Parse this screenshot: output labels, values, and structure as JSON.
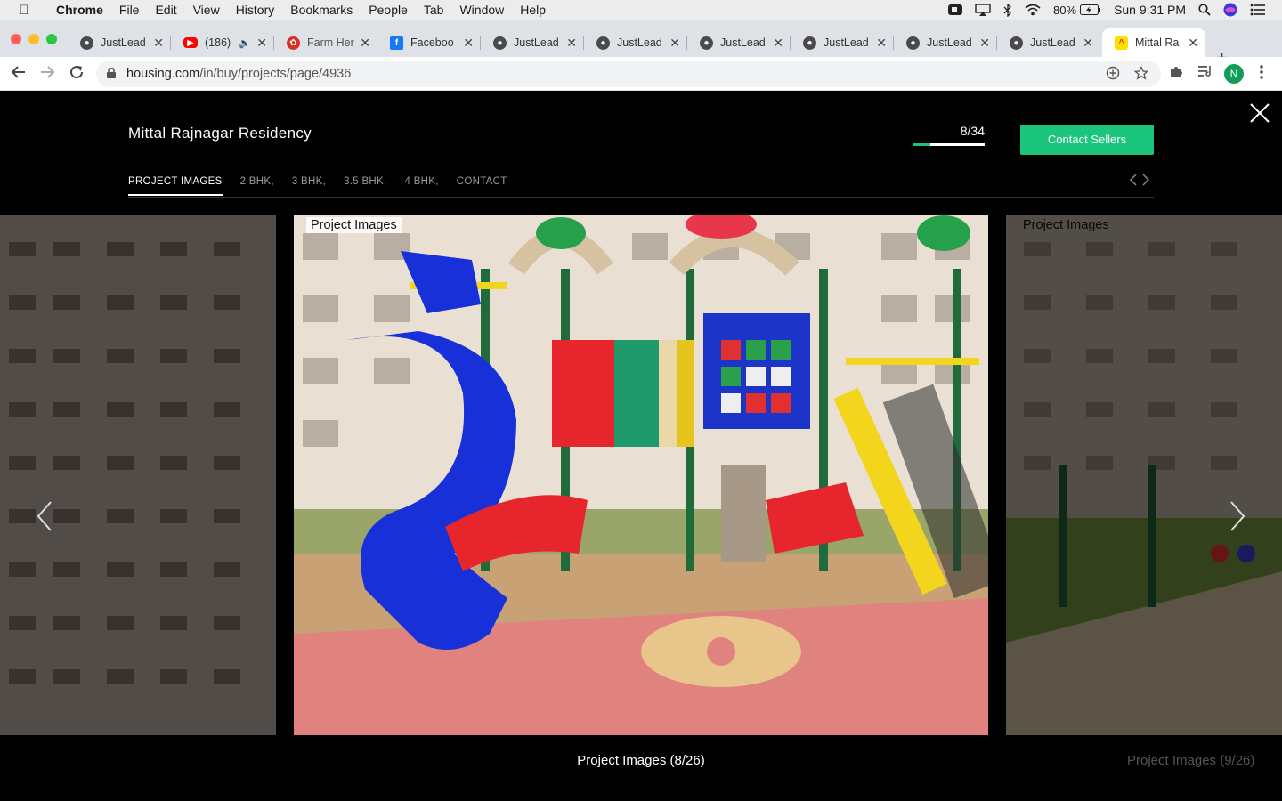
{
  "menubar": {
    "items": [
      "Chrome",
      "File",
      "Edit",
      "View",
      "History",
      "Bookmarks",
      "People",
      "Tab",
      "Window",
      "Help"
    ],
    "battery": "80%",
    "clock": "Sun 9:31 PM"
  },
  "tabs": [
    {
      "title": "JustLead",
      "favicon": "globe-icon"
    },
    {
      "title": "(186)",
      "favicon": "youtube-icon"
    },
    {
      "title": "Farm Her",
      "favicon": "strawberry-icon"
    },
    {
      "title": "Faceboo",
      "favicon": "facebook-icon"
    },
    {
      "title": "JustLead",
      "favicon": "globe-icon"
    },
    {
      "title": "JustLead",
      "favicon": "globe-icon"
    },
    {
      "title": "JustLead",
      "favicon": "globe-icon"
    },
    {
      "title": "JustLead",
      "favicon": "globe-icon"
    },
    {
      "title": "JustLead",
      "favicon": "globe-icon"
    },
    {
      "title": "JustLead",
      "favicon": "globe-icon"
    },
    {
      "title": "Mittal Ra",
      "favicon": "housing-icon",
      "active": true
    }
  ],
  "address": {
    "host": "housing.com",
    "path": "/in/buy/projects/page/4936"
  },
  "profile_initial": "N",
  "gallery": {
    "project_title": "Mittal Rajnagar Residency",
    "counter": "8/34",
    "progress_fraction": 0.2353,
    "contact_label": "Contact Sellers",
    "tabs": [
      "PROJECT IMAGES",
      "2 BHK,",
      "3 BHK,",
      "3.5 BHK,",
      "4 BHK,",
      "CONTACT"
    ],
    "active_tab": 0,
    "current_slide_label": "Project Images",
    "next_slide_label": "Project Images",
    "current_caption": "Project Images (8/26)",
    "next_caption": "Project Images (9/26)"
  },
  "colors": {
    "accent": "#1cc57c",
    "menubar": "#ececec",
    "tabstrip": "#dee1e6"
  }
}
